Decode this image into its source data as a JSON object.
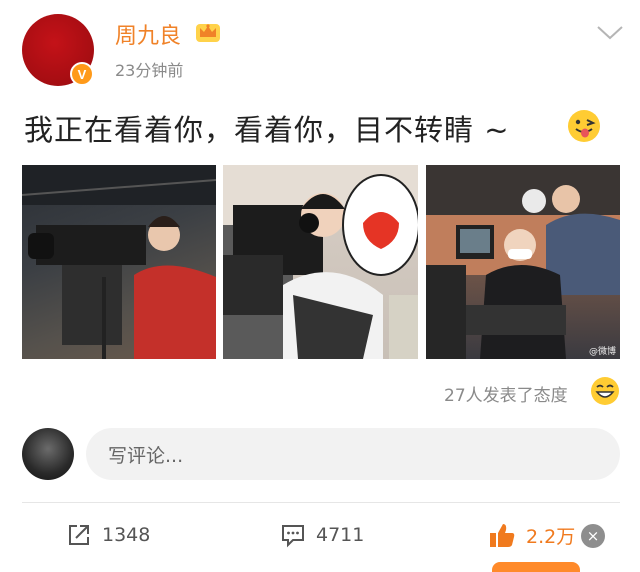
{
  "post": {
    "username": "周九良",
    "timestamp": "23分钟前",
    "verified_badge": "V",
    "text": "我正在看着你，看着你，目不转睛 ~",
    "watermark": "@微博",
    "reactions": "27人发表了态度"
  },
  "comment": {
    "placeholder": "写评论..."
  },
  "actions": {
    "share": "1348",
    "comment": "4711",
    "like": "2.2万",
    "close": "×"
  },
  "colors": {
    "username": "#f08228",
    "verified": "#ff9a1a",
    "like": "#f07a1e"
  }
}
